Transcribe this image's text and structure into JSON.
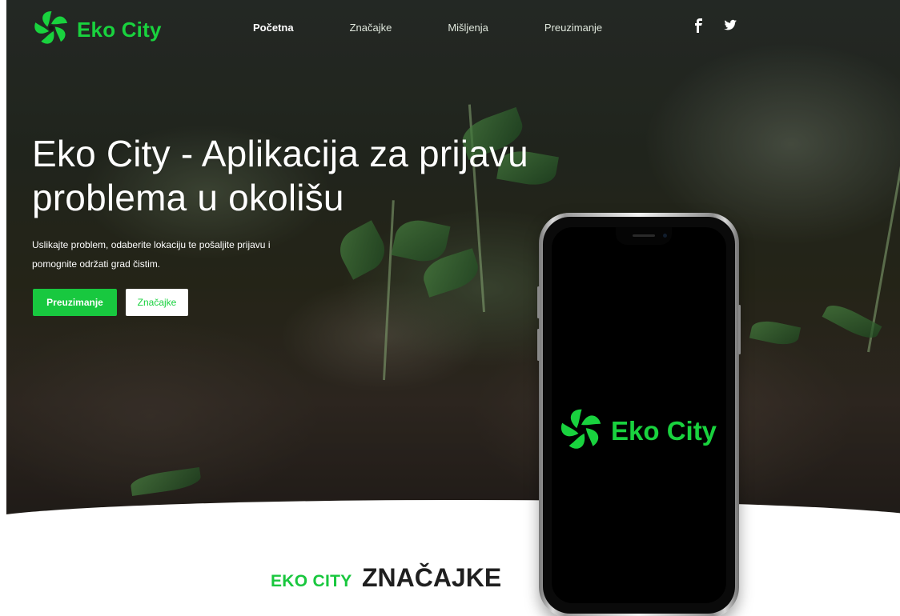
{
  "brand": {
    "name": "Eko City",
    "color": "#19d23e",
    "icon": "pinwheel-logo-icon"
  },
  "nav": {
    "items": [
      {
        "label": "Početna",
        "active": true
      },
      {
        "label": "Značajke",
        "active": false
      },
      {
        "label": "Mišljenja",
        "active": false
      },
      {
        "label": "Preuzimanje",
        "active": false
      }
    ],
    "social": [
      {
        "icon": "facebook-icon"
      },
      {
        "icon": "twitter-icon"
      }
    ]
  },
  "hero": {
    "title": "Eko City - Aplikacija za prijavu problema u okolišu",
    "description": "Uslikajte problem, odaberite lokaciju te pošaljite prijavu i pomognite održati grad čistim.",
    "primary_button": "Preuzimanje",
    "secondary_button": "Značajke",
    "accent_color": "#18c83f"
  },
  "phone": {
    "brand": "Eko City",
    "screen_color": "#000000"
  },
  "section": {
    "small_title": "EKO CITY",
    "big_title": "ZNAČAJKE"
  }
}
